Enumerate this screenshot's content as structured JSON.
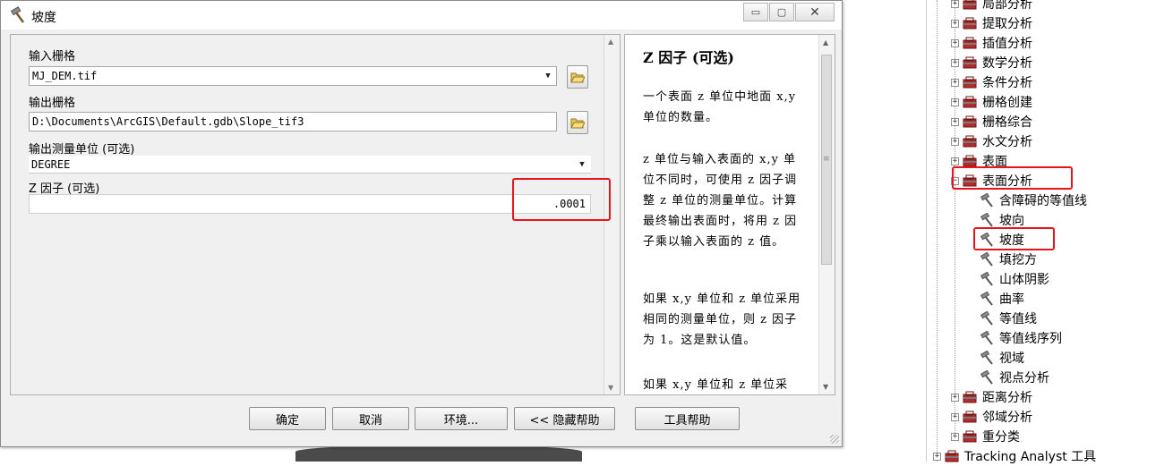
{
  "dialog": {
    "title": "坡度",
    "window_buttons": {
      "minimize": "▭",
      "maximize": "▢",
      "close": "✕"
    },
    "fields": {
      "input_raster": {
        "label": "输入栅格",
        "value": "MJ_DEM.tif"
      },
      "output_raster": {
        "label": "输出栅格",
        "value": "D:\\Documents\\ArcGIS\\Default.gdb\\Slope_tif3"
      },
      "output_unit": {
        "label": "输出测量单位 (可选)",
        "value": "DEGREE"
      },
      "z_factor": {
        "label": "Z 因子 (可选)",
        "value": ".0001"
      }
    },
    "help": {
      "title": "Z 因子 (可选)",
      "paragraphs": [
        "一个表面 z 单位中地面 x,y 单位的数量。",
        "z 单位与输入表面的 x,y 单位不同时，可使用 z 因子调整 z 单位的测量单位。计算最终输出表面时，将用 z 因子乘以输入表面的 z 值。",
        "如果 x,y 单位和 z 单位采用相同的测量单位，则 z 因子为 1。这是默认值。",
        "如果 x,y 单位和 z 单位采"
      ]
    },
    "buttons": {
      "ok": "确定",
      "cancel": "取消",
      "environments": "环境...",
      "hide_help": "<< 隐藏帮助",
      "tool_help": "工具帮助"
    }
  },
  "toolbox_tree": {
    "toolsets": [
      {
        "label": "局部分析",
        "expander": "+"
      },
      {
        "label": "提取分析",
        "expander": "+"
      },
      {
        "label": "插值分析",
        "expander": "+"
      },
      {
        "label": "数学分析",
        "expander": "+"
      },
      {
        "label": "条件分析",
        "expander": "+"
      },
      {
        "label": "栅格创建",
        "expander": "+"
      },
      {
        "label": "栅格综合",
        "expander": "+"
      },
      {
        "label": "水文分析",
        "expander": "+"
      },
      {
        "label": "表面",
        "expander": "+"
      },
      {
        "label": "表面分析",
        "expander": "−"
      }
    ],
    "tools": [
      "含障碍的等值线",
      "坡向",
      "坡度",
      "填挖方",
      "山体阴影",
      "曲率",
      "等值线",
      "等值线序列",
      "视域",
      "视点分析"
    ],
    "toolsets_after": [
      {
        "label": "距离分析",
        "expander": "+"
      },
      {
        "label": "邻域分析",
        "expander": "+"
      },
      {
        "label": "重分类",
        "expander": "+"
      }
    ],
    "root_toolbox": {
      "label": "Tracking Analyst 工具",
      "expander": "+"
    }
  },
  "colors": {
    "highlight": "#e8141b",
    "toolbox_red": "#b52a2a"
  }
}
